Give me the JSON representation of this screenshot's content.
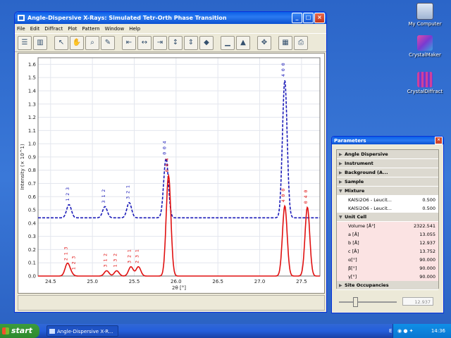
{
  "desktop": {
    "icons": [
      {
        "label": "My Computer"
      },
      {
        "label": "CrystalMaker"
      },
      {
        "label": "CrystalDiffract"
      }
    ]
  },
  "window": {
    "title": "Angle-Dispersive X-Rays: Simulated Tetr-Orth Phase Transition",
    "menu": [
      "File",
      "Edit",
      "Diffract",
      "Plot",
      "Pattern",
      "Window",
      "Help"
    ]
  },
  "chart_data": {
    "type": "line",
    "xlabel": "2θ [°]",
    "ylabel": "Intensity (× 10^1)",
    "xlim": [
      24.35,
      27.72
    ],
    "ylim": [
      0,
      1.65
    ],
    "x_ticks": [
      "24.5",
      "25.0",
      "25.5",
      "26.0",
      "26.5",
      "27.0",
      "27.5"
    ],
    "y_ticks": [
      "0.0",
      "0.1",
      "0.2",
      "0.3",
      "0.4",
      "0.5",
      "0.6",
      "0.7",
      "0.8",
      "0.9",
      "1.0",
      "1.1",
      "1.2",
      "1.3",
      "1.4",
      "1.5",
      "1.6"
    ],
    "grid": true,
    "series": [
      {
        "style": "dashed",
        "color": "#1a1ab8",
        "baseline": 0.44,
        "peaks": [
          {
            "x": 24.72,
            "height": 0.1,
            "label": "1 2 3"
          },
          {
            "x": 25.15,
            "height": 0.085,
            "label": "3 1 2"
          },
          {
            "x": 25.44,
            "height": 0.115,
            "label": "3 2 1"
          },
          {
            "x": 25.88,
            "height": 0.45,
            "label": "0 0 4"
          },
          {
            "x": 27.3,
            "height": 1.04,
            "label": "4 0 0"
          }
        ]
      },
      {
        "style": "solid",
        "color": "#e01010",
        "baseline": 0.0,
        "peaks": [
          {
            "x": 24.7,
            "height": 0.09,
            "label": "2 1 3"
          },
          {
            "x": 24.74,
            "height": 0.02,
            "label": "1 2 3"
          },
          {
            "x": 25.17,
            "height": 0.04,
            "label": "3 1 2"
          },
          {
            "x": 25.29,
            "height": 0.04,
            "label": "1 3 2"
          },
          {
            "x": 25.46,
            "height": 0.07,
            "label": "3 2 1"
          },
          {
            "x": 25.55,
            "height": 0.07,
            "label": "2 3 1"
          },
          {
            "x": 25.91,
            "height": 0.76,
            "label": "0 0 4"
          },
          {
            "x": 27.3,
            "height": 0.53,
            "label": "4 0 0"
          },
          {
            "x": 27.57,
            "height": 0.52,
            "label": "0 4 0"
          }
        ]
      }
    ]
  },
  "parameters": {
    "title": "Parameters",
    "sections": [
      {
        "label": "Angle Dispersive",
        "open": false
      },
      {
        "label": "Instrument",
        "open": false
      },
      {
        "label": "Background (A...",
        "open": false
      },
      {
        "label": "Sample",
        "open": false
      },
      {
        "label": "Mixture",
        "open": true
      }
    ],
    "mixture": [
      {
        "name": "KAlSi2O6 - Leucit...",
        "value": "0.500"
      },
      {
        "name": "KAlSi2O6 - Leucit...",
        "value": "0.500"
      }
    ],
    "unit_cell_label": "Unit Cell",
    "unit_cell": [
      {
        "name": "Volume [Å³]",
        "value": "2322.541"
      },
      {
        "name": "a [Å]",
        "value": "13.055"
      },
      {
        "name": "b [Å]",
        "value": "12.937"
      },
      {
        "name": "c [Å]",
        "value": "13.752"
      },
      {
        "name": "α[°]",
        "value": "90.000"
      },
      {
        "name": "β[°]",
        "value": "90.000"
      },
      {
        "name": "γ[°]",
        "value": "90.000"
      }
    ],
    "site_occupancies_label": "Site Occupancies",
    "slider_value": "12.937"
  },
  "taskbar": {
    "start": "start",
    "task": "Angle-Dispersive X-R...",
    "lang": "EN",
    "clock": "14:36"
  }
}
